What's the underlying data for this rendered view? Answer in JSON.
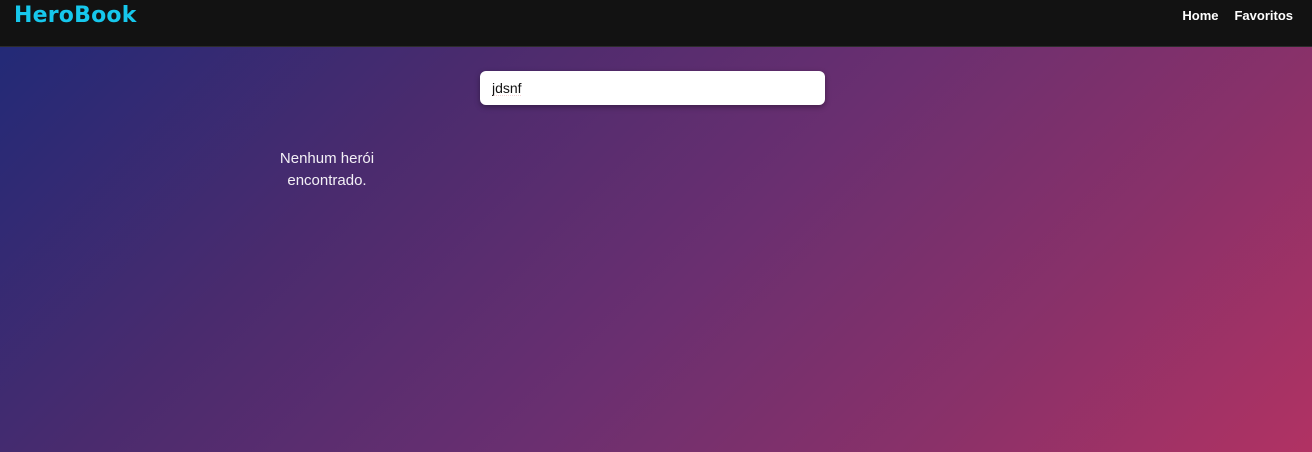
{
  "header": {
    "brand": "HeroBook",
    "nav": [
      {
        "label": "Home"
      },
      {
        "label": "Favoritos"
      }
    ]
  },
  "search": {
    "value": "jdsnf"
  },
  "results": {
    "empty_message": "Nenhum herói encontrado."
  },
  "colors": {
    "brand": "#16c7ec",
    "navbar": "#121212",
    "gradient_start": "#1f2a78",
    "gradient_end": "#b13263"
  }
}
